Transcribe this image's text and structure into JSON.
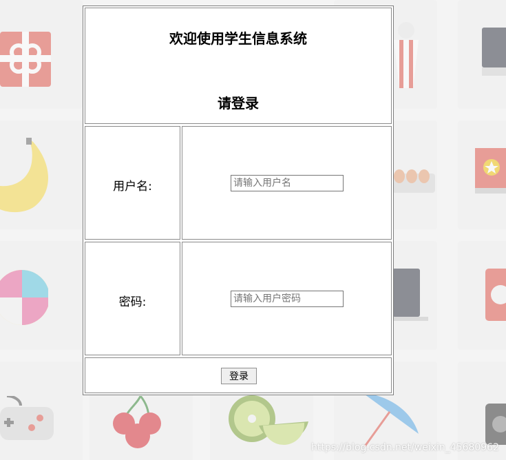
{
  "header": {
    "title": "欢迎使用学生信息系统",
    "subtitle": "请登录"
  },
  "form": {
    "username_label": "用户名:",
    "username_placeholder": "请输入用户名",
    "username_value": "",
    "password_label": "密码:",
    "password_placeholder": "请输入用户密码",
    "password_value": "",
    "submit_label": "登录"
  },
  "watermark": "https://blog.csdn.net/weixin_45680962",
  "background": {
    "icons": [
      "gift-icon",
      "popcorn-icon",
      "monitor-icon",
      "banana-icon",
      "eggs-icon",
      "award-box-icon",
      "beach-ball-icon",
      "laptop-icon",
      "camera-lens-icon",
      "gamepad-icon",
      "cherries-icon",
      "kiwi-icon",
      "umbrella-icon",
      "camera-icon"
    ]
  }
}
